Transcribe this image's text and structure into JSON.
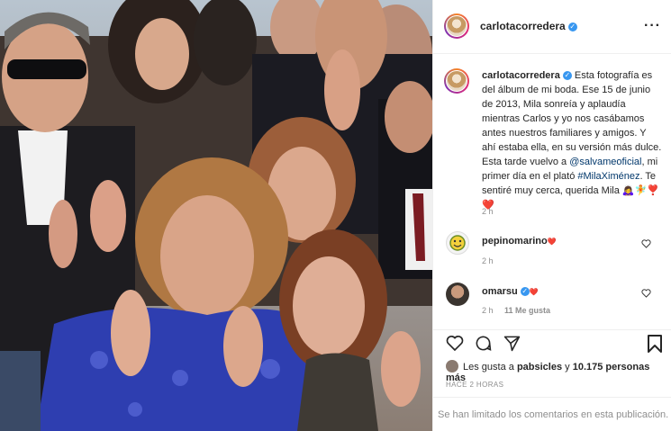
{
  "post": {
    "author": "carlotacorredera",
    "menu_icon": "more-horizontal-icon"
  },
  "caption": {
    "username": "carlotacorredera",
    "text_1": "Esta fotografía es del álbum de mi boda. Ese 15 de junio de 2013, Mila sonreía y aplaudía mientras Carlos y yo nos casábamos antes nuestros familiares y amigos. Y ahí estaba ella, en su versión más dulce. Esta tarde vuelvo a ",
    "mention": "@salvameoficial",
    "text_2": ", mi primer día en el plató ",
    "hashtag": "#MilaXiménez",
    "text_3": ". Te sentiré muy cerca, querida Mila 🙇‍♀️🧚❣️❤️",
    "time": "2 h"
  },
  "comments": [
    {
      "username": "pepinomarino",
      "suffix": "❤️",
      "time": "2 h",
      "likes": ""
    },
    {
      "username": "omarsu",
      "suffix": "❤️",
      "time": "2 h",
      "likes": "11 Me gusta"
    }
  ],
  "likes": {
    "prefix": "Les gusta a ",
    "user": "pabsicles",
    "middle": " y ",
    "count": "10.175 personas más"
  },
  "posted_ago": "HACE 2 HORAS",
  "comments_limited": "Se han limitado los comentarios en esta publicación.",
  "colors": {
    "verified": "#3897f0",
    "link": "#00376b",
    "muted": "#8e8e8e",
    "border": "#efefef"
  }
}
